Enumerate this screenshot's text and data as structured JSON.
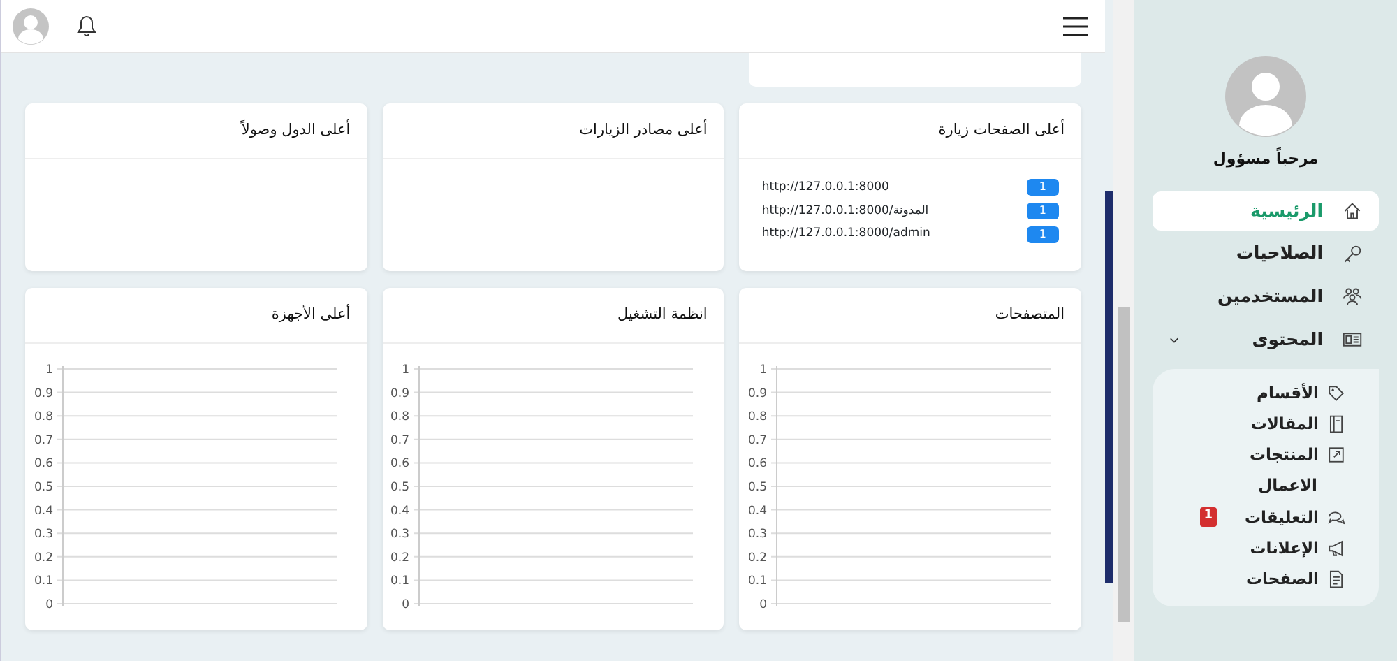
{
  "sidebar": {
    "greeting": "مرحباً مسؤول",
    "items": [
      {
        "label": "الرئيسية",
        "selected": true
      },
      {
        "label": "الصلاحيات",
        "selected": false
      },
      {
        "label": "المستخدمين",
        "selected": false
      },
      {
        "label": "المحتوى",
        "selected": false,
        "expanded": true,
        "children": [
          {
            "label": "الأقسام"
          },
          {
            "label": "المقالات"
          },
          {
            "label": "المنتجات"
          },
          {
            "label": "الاعمال"
          },
          {
            "label": "التعليقات",
            "badge": "1"
          },
          {
            "label": "الإعلانات"
          },
          {
            "label": "الصفحات"
          }
        ]
      }
    ]
  },
  "cards": [
    {
      "title": "أعلى الصفحات زيارة",
      "rows": [
        {
          "url": "http://127.0.0.1:8000",
          "count": "1"
        },
        {
          "url": "http://127.0.0.1:8000/المدونة",
          "count": "1"
        },
        {
          "url": "http://127.0.0.1:8000/admin",
          "count": "1"
        }
      ]
    },
    {
      "title": "أعلى مصادر الزيارات"
    },
    {
      "title": "أعلى الدول وصولاً"
    },
    {
      "title": "المتصفحات",
      "chart_data": {
        "type": "line",
        "grid": true,
        "categories": [
          null,
          null
        ],
        "values": [
          null,
          null
        ],
        "ylim": [
          0,
          1
        ],
        "yticks": [
          0,
          0.1,
          0.2,
          0.3,
          0.4,
          0.5,
          0.6,
          0.7,
          0.8,
          0.9,
          1
        ]
      }
    },
    {
      "title": "انظمة التشغيل",
      "chart_data": {
        "type": "line",
        "grid": true,
        "categories": [
          null,
          null
        ],
        "values": [
          null,
          null
        ],
        "ylim": [
          0,
          1
        ],
        "yticks": [
          0,
          0.1,
          0.2,
          0.3,
          0.4,
          0.5,
          0.6,
          0.7,
          0.8,
          0.9,
          1
        ]
      }
    },
    {
      "title": "أعلى الأجهزة",
      "chart_data": {
        "type": "line",
        "grid": true,
        "categories": [
          null,
          null
        ],
        "values": [
          null,
          null
        ],
        "ylim": [
          0,
          1
        ],
        "yticks": [
          0,
          0.1,
          0.2,
          0.3,
          0.4,
          0.5,
          0.6,
          0.7,
          0.8,
          0.9,
          1
        ]
      }
    }
  ]
}
